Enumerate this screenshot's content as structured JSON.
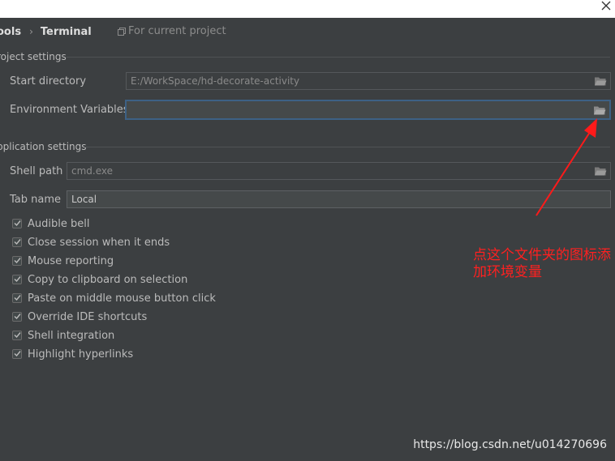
{
  "breadcrumb": {
    "parent": "ools",
    "current": "Terminal"
  },
  "scope": {
    "text": "For current project",
    "icon": "copy-icon"
  },
  "project_settings": {
    "title": "roject settings",
    "start_directory": {
      "label": "Start directory",
      "value": "E:/WorkSpace/hd-decorate-activity"
    },
    "environment_variables": {
      "label": "Environment Variables",
      "value": ""
    }
  },
  "application_settings": {
    "title": "pplication settings",
    "shell_path": {
      "label": "Shell path",
      "value": "cmd.exe"
    },
    "tab_name": {
      "label": "Tab name",
      "value": "Local"
    },
    "options": [
      {
        "label": "Audible bell",
        "checked": true
      },
      {
        "label": "Close session when it ends",
        "checked": true
      },
      {
        "label": "Mouse reporting",
        "checked": true
      },
      {
        "label": "Copy to clipboard on selection",
        "checked": true
      },
      {
        "label": "Paste on middle mouse button click",
        "checked": true
      },
      {
        "label": "Override IDE shortcuts",
        "checked": true
      },
      {
        "label": "Shell integration",
        "checked": true
      },
      {
        "label": "Highlight hyperlinks",
        "checked": true
      }
    ]
  },
  "annotation": {
    "text": "点这个文件夹的图标添加环境变量",
    "color": "#ff2020"
  },
  "watermark": "https://blog.csdn.net/u014270696",
  "colors": {
    "background": "#3c3f41",
    "focus_border": "#3d6185",
    "annotation_red": "#ff2020"
  }
}
